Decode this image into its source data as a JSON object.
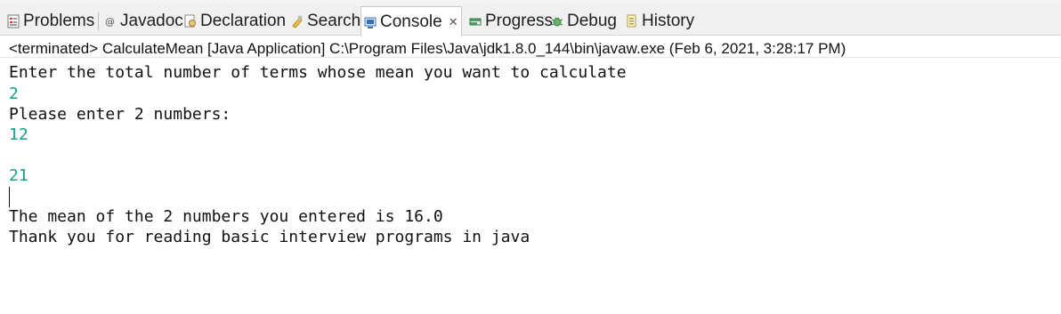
{
  "tabs": [
    {
      "label": "Problems",
      "icon": "problems-icon"
    },
    {
      "label": "Javadoc",
      "icon": "javadoc-icon"
    },
    {
      "label": "Declaration",
      "icon": "declaration-icon"
    },
    {
      "label": "Search",
      "icon": "search-icon"
    },
    {
      "label": "Console",
      "icon": "console-icon",
      "active": true
    },
    {
      "label": "Progress",
      "icon": "progress-icon"
    },
    {
      "label": "Debug",
      "icon": "debug-icon"
    },
    {
      "label": "History",
      "icon": "history-icon"
    }
  ],
  "close_glyph": "✕",
  "console": {
    "status": "<terminated> CalculateMean [Java Application] C:\\Program Files\\Java\\jdk1.8.0_144\\bin\\javaw.exe (Feb 6, 2021, 3:28:17 PM)",
    "lines": [
      {
        "text": "Enter the total number of terms whose mean you want to calculate",
        "kind": "output"
      },
      {
        "text": "2",
        "kind": "input"
      },
      {
        "text": "Please enter 2 numbers:",
        "kind": "output"
      },
      {
        "text": "12",
        "kind": "input"
      },
      {
        "text": "21",
        "kind": "input"
      },
      {
        "text": "The mean of the 2 numbers you entered is 16.0",
        "kind": "output"
      },
      {
        "text": "Thank you for reading basic interview programs in java",
        "kind": "output"
      }
    ]
  },
  "colors": {
    "input_text": "#16a085",
    "output_text": "#111111",
    "tab_bar": "#f0f0f0"
  }
}
